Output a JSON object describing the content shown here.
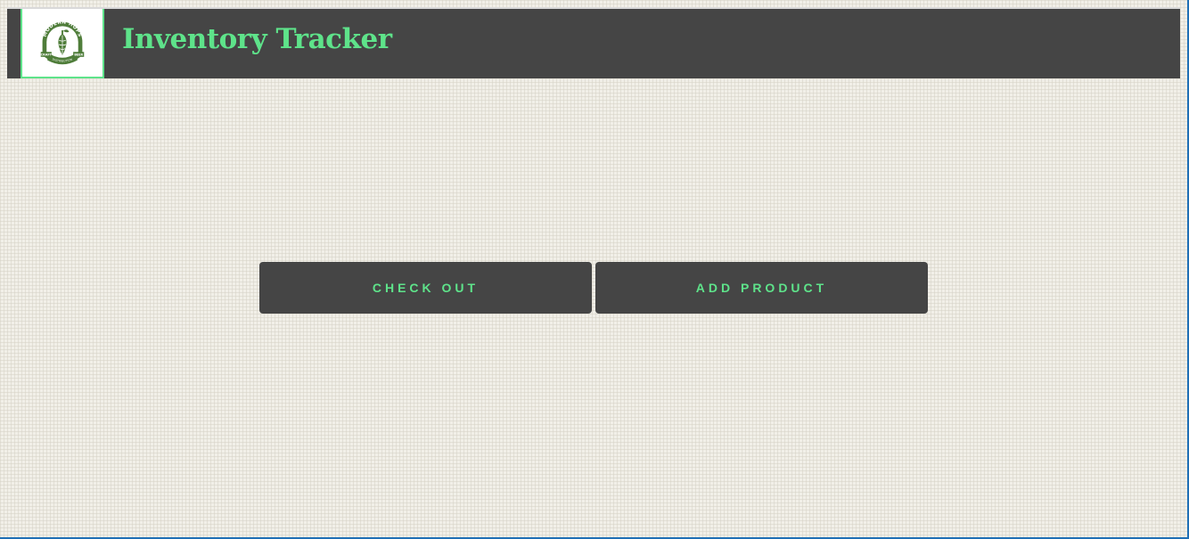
{
  "header": {
    "title": "Inventory Tracker",
    "logo": {
      "icon": "hop-cone-icon",
      "text_top": "MODERN HOPS",
      "text_left": "CRAFT",
      "text_right": "BEER",
      "text_bottom": "DISTRIBUTION",
      "color": "#4f7d3a"
    }
  },
  "actions": {
    "checkout_label": "CHECK OUT",
    "add_product_label": "ADD PRODUCT"
  },
  "colors": {
    "accent": "#5ee38a",
    "bar": "#454545",
    "background": "#f1efe8",
    "frame": "#1f6fb5"
  }
}
